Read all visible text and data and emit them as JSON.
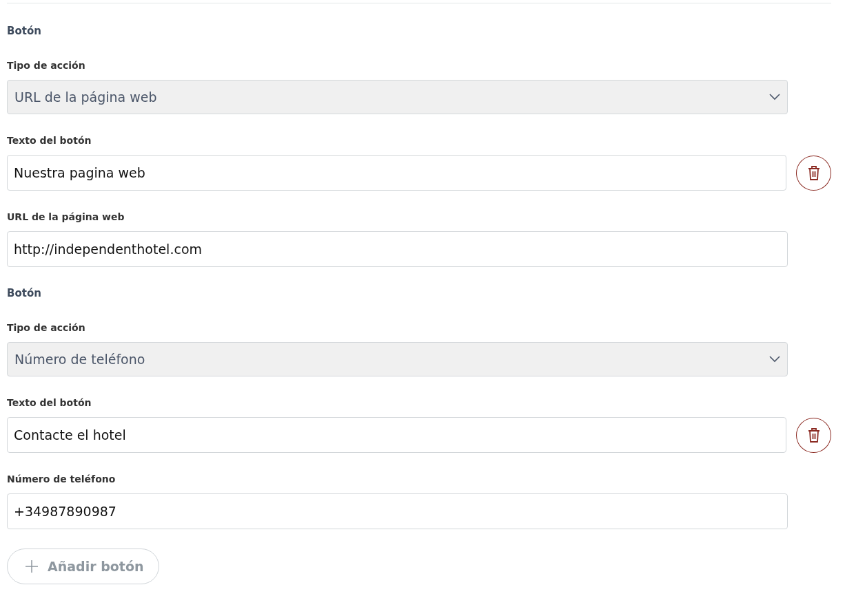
{
  "buttons": [
    {
      "heading": "Botón",
      "action_label": "Tipo de acción",
      "action_value": "URL de la página web",
      "text_label": "Texto del botón",
      "text_value": "Nuestra pagina web",
      "target_label": "URL de la página web",
      "target_value": "http://independenthotel.com"
    },
    {
      "heading": "Botón",
      "action_label": "Tipo de acción",
      "action_value": "Número de teléfono",
      "text_label": "Texto del botón",
      "text_value": "Contacte el hotel",
      "target_label": "Número de teléfono",
      "target_value": "+34987890987"
    }
  ],
  "add_button": {
    "label": "Añadir botón",
    "disabled": true
  }
}
